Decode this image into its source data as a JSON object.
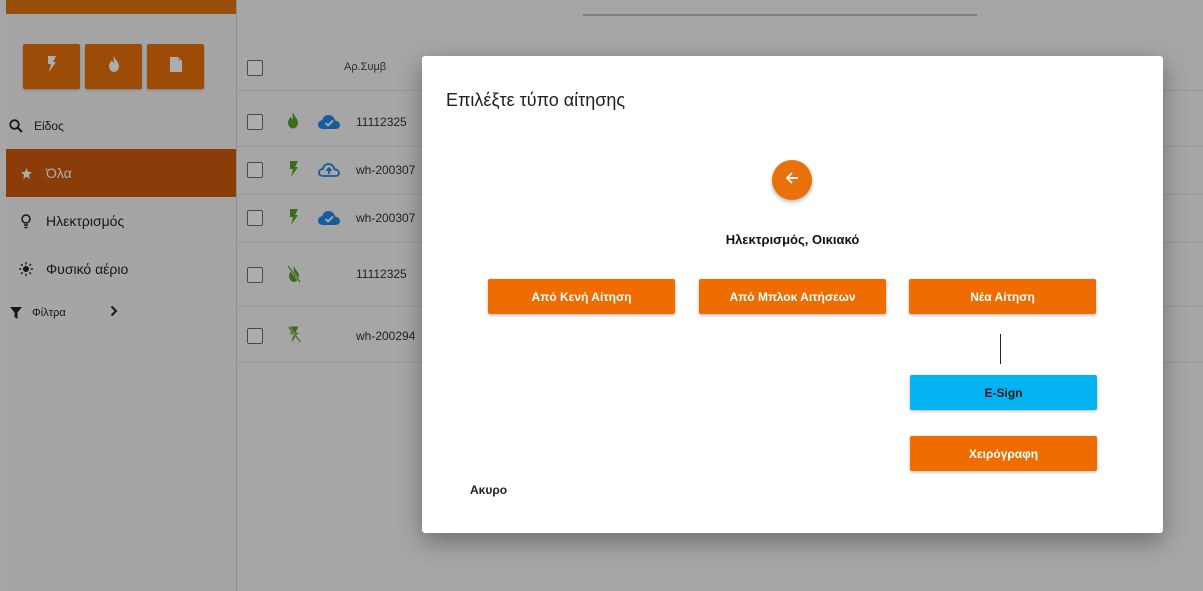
{
  "sidebar": {
    "type_buttons": [
      {
        "icon": "lightning-icon"
      },
      {
        "icon": "flame-icon"
      },
      {
        "icon": "document-icon"
      }
    ],
    "search_label": "Είδος",
    "items": [
      {
        "label": "Όλα",
        "icon": "star-icon",
        "active": true
      },
      {
        "label": "Ηλεκτρισμός",
        "icon": "bulb-icon"
      },
      {
        "label": "Φυσικό αέριο",
        "icon": "sun-icon"
      }
    ],
    "filters_label": "Φίλτρα"
  },
  "list": {
    "header": {
      "column_contract": "Αρ.Συμβ"
    },
    "rows": [
      {
        "type_icon": "flame-icon",
        "status_icon": "cloud-check-icon",
        "contract": "11112325"
      },
      {
        "type_icon": "lightning-icon",
        "status_icon": "cloud-upload-icon",
        "contract": "wh-200307"
      },
      {
        "type_icon": "lightning-icon",
        "status_icon": "cloud-check-icon",
        "contract": "wh-200307"
      },
      {
        "type_icon": "flame-off-icon",
        "status_icon": "",
        "contract": "11112325"
      },
      {
        "type_icon": "lightning-off-icon",
        "status_icon": "",
        "contract": "wh-200294"
      }
    ]
  },
  "dialog": {
    "title": "Επιλέξτε τύπο αίτησης",
    "subtitle": "Ηλεκτρισμός, Οικιακό",
    "buttons": {
      "blank": "Από Κενή Αίτηση",
      "block": "Από Μπλοκ Αιτήσεων",
      "new": "Νέα Αίτηση",
      "esign": "E-Sign",
      "handwritten": "Χειρόγραφη"
    },
    "cancel": "Ακυρο"
  },
  "colors": {
    "accent": "#ef6c00",
    "sidebar_active": "#cc5a0d",
    "esign": "#03b3f2",
    "gas_green": "#5aa02c",
    "cloud_blue": "#1e88e5"
  }
}
